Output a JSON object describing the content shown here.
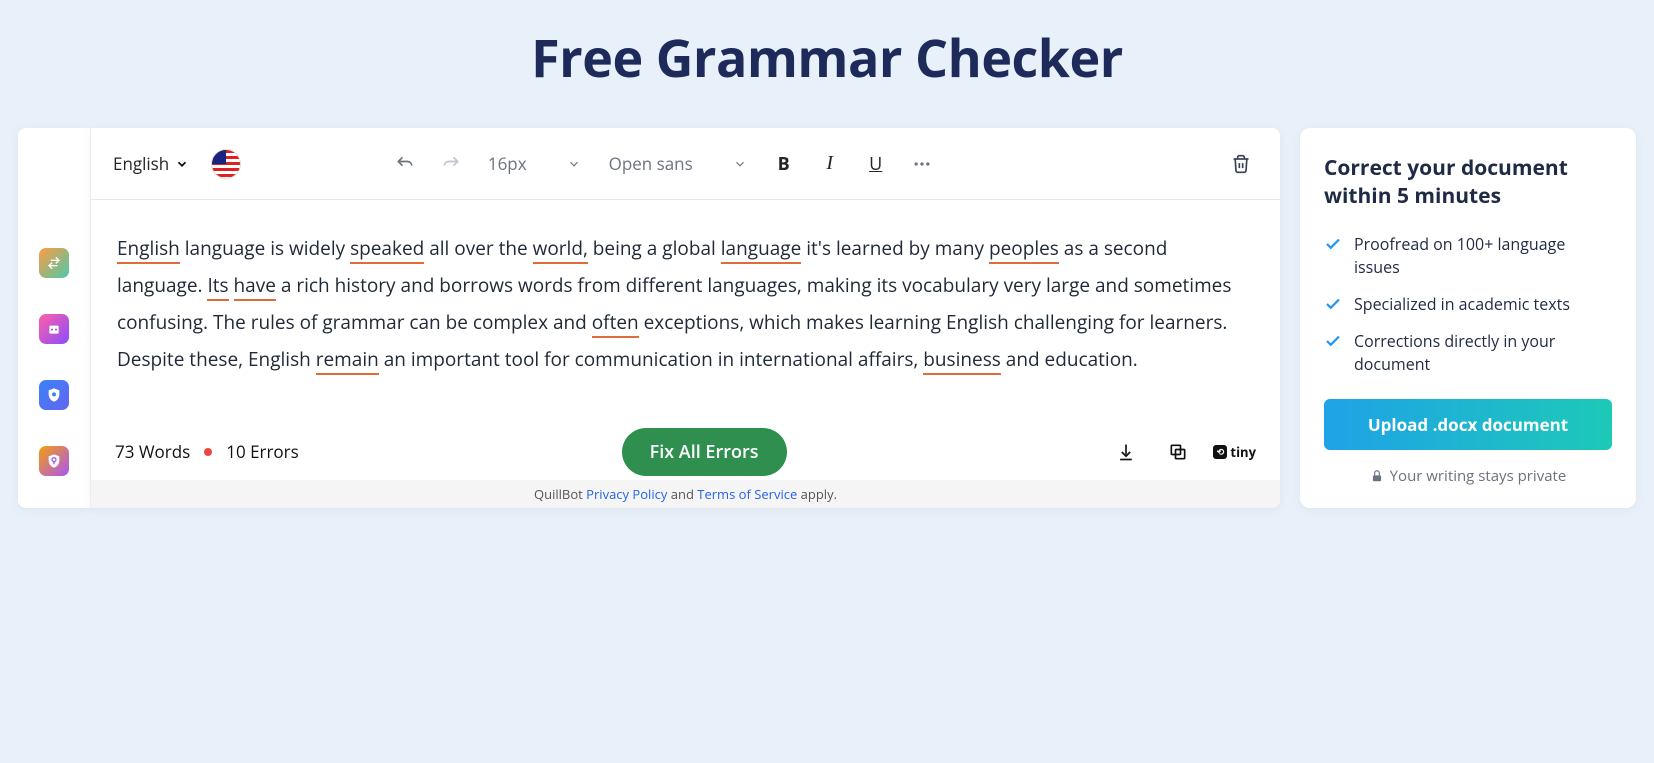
{
  "page_title": "Free Grammar Checker",
  "toolbar": {
    "language": "English",
    "font_size": "16px",
    "font_family": "Open sans"
  },
  "editor": {
    "tokens": [
      {
        "t": "English",
        "e": true
      },
      {
        "t": " language is widely "
      },
      {
        "t": "speaked",
        "e": true
      },
      {
        "t": " all over the "
      },
      {
        "t": "world,",
        "e": true
      },
      {
        "t": " being a global "
      },
      {
        "t": "language",
        "e": true
      },
      {
        "t": " it's learned by many "
      },
      {
        "t": "peoples",
        "e": true
      },
      {
        "t": " as a second language. "
      },
      {
        "t": "Its",
        "e": true
      },
      {
        "t": " "
      },
      {
        "t": "have",
        "e": true
      },
      {
        "t": " a rich history and borrows words from different languages, making its vocabulary very large and sometimes confusing. The rules of grammar can be complex and "
      },
      {
        "t": "often",
        "e": true
      },
      {
        "t": " exceptions, which makes learning English challenging for learners. Despite these, English "
      },
      {
        "t": "remain",
        "e": true
      },
      {
        "t": " an important tool for communication in international affairs, "
      },
      {
        "t": "business",
        "e": true
      },
      {
        "t": " and education."
      }
    ]
  },
  "footer": {
    "word_count": "73 Words",
    "error_count": "10 Errors",
    "fix_button": "Fix All Errors",
    "tiny_label": "tiny"
  },
  "legal": {
    "prefix": "QuillBot ",
    "privacy": "Privacy Policy",
    "mid": " and ",
    "terms": "Terms of Service",
    "suffix": " apply."
  },
  "promo": {
    "heading": "Correct your document within 5 minutes",
    "items": [
      "Proofread on 100+ language issues",
      "Specialized in academic texts",
      "Corrections directly in your document"
    ],
    "upload": "Upload .docx document",
    "privacy": "Your writing stays private"
  }
}
